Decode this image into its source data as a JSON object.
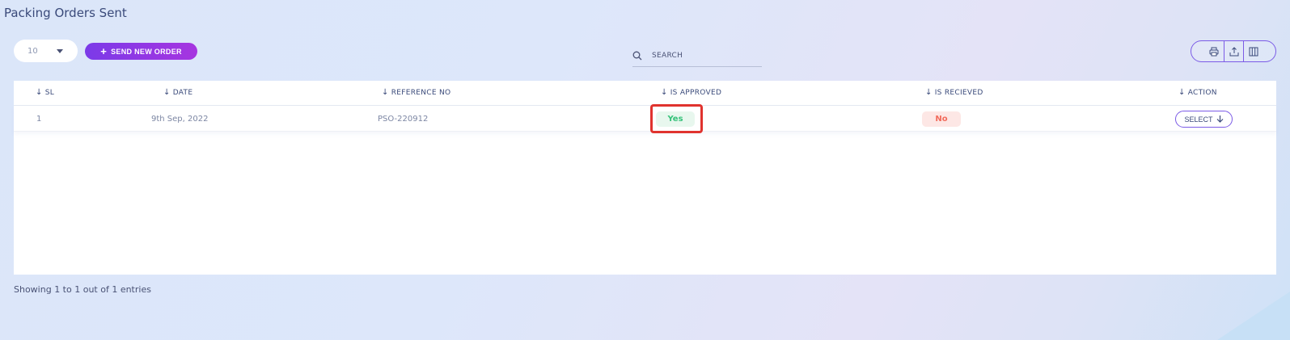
{
  "page": {
    "title": "Packing Orders Sent"
  },
  "toolbar": {
    "page_size": "10",
    "send_button": "SEND NEW ORDER",
    "send_icon": "plus-icon",
    "search_placeholder": "SEARCH",
    "search_icon": "search-icon",
    "tools": [
      "print-icon",
      "export-icon",
      "columns-icon"
    ]
  },
  "table": {
    "columns": [
      "SL",
      "DATE",
      "REFERENCE NO",
      "IS APPROVED",
      "IS RECIEVED",
      "ACTION"
    ],
    "rows": [
      {
        "sl": "1",
        "date": "9th Sep, 2022",
        "ref": "PSO-220912",
        "approved": "Yes",
        "received": "No",
        "action": "SELECT"
      }
    ]
  },
  "footer": {
    "info": "Showing 1 to 1 out of 1 entries"
  },
  "colors": {
    "accent": "#7b3ae8",
    "yes_badge": "#36c27a",
    "no_badge": "#f26b5b",
    "highlight": "#e0332e"
  }
}
